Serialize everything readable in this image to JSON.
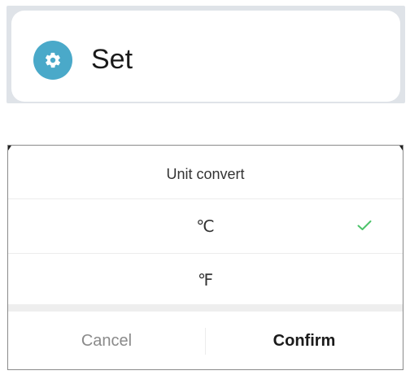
{
  "set_panel": {
    "icon": "gear-icon",
    "label": "Set",
    "icon_color": "#4aa9c9"
  },
  "dialog": {
    "title": "Unit convert",
    "options": [
      {
        "label": "℃",
        "selected": true
      },
      {
        "label": "℉",
        "selected": false
      }
    ],
    "check_icon": "checkmark-icon",
    "check_color": "#4cc36a",
    "cancel_label": "Cancel",
    "confirm_label": "Confirm"
  }
}
